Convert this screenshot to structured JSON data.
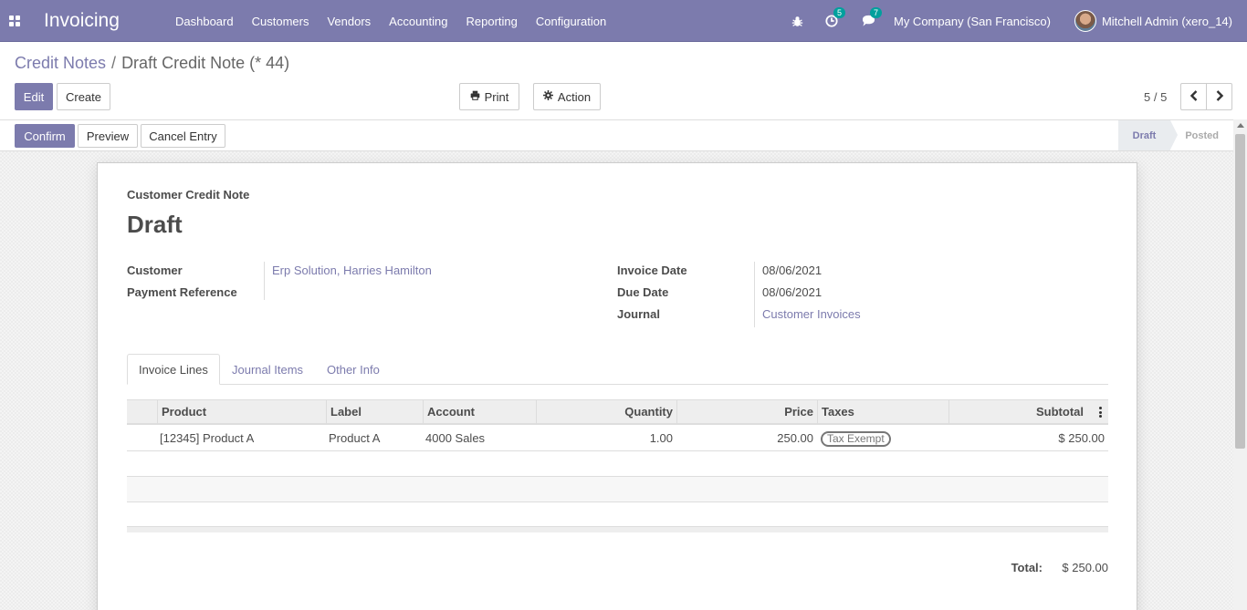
{
  "navbar": {
    "app_name": "Invoicing",
    "menu": [
      "Dashboard",
      "Customers",
      "Vendors",
      "Accounting",
      "Reporting",
      "Configuration"
    ],
    "activity_count": "5",
    "messages_count": "7",
    "company": "My Company (San Francisco)",
    "user": "Mitchell Admin (xero_14)"
  },
  "breadcrumb": {
    "parent": "Credit Notes",
    "separator": "/",
    "current": "Draft Credit Note (* 44)"
  },
  "buttons": {
    "edit": "Edit",
    "create": "Create",
    "print": "Print",
    "action": "Action",
    "confirm": "Confirm",
    "preview": "Preview",
    "cancel_entry": "Cancel Entry"
  },
  "pager": {
    "value": "5 / 5"
  },
  "status": {
    "stages": [
      "Draft",
      "Posted"
    ],
    "active": "Draft"
  },
  "form": {
    "doc_type": "Customer Credit Note",
    "title": "Draft",
    "customer_label": "Customer",
    "customer_value": "Erp Solution, Harries Hamilton",
    "payment_ref_label": "Payment Reference",
    "payment_ref_value": "",
    "invoice_date_label": "Invoice Date",
    "invoice_date_value": "08/06/2021",
    "due_date_label": "Due Date",
    "due_date_value": "08/06/2021",
    "journal_label": "Journal",
    "journal_value": "Customer Invoices"
  },
  "tabs": [
    "Invoice Lines",
    "Journal Items",
    "Other Info"
  ],
  "table": {
    "columns": [
      "Product",
      "Label",
      "Account",
      "Quantity",
      "Price",
      "Taxes",
      "Subtotal"
    ],
    "rows": [
      {
        "product": "[12345] Product A",
        "label": "Product A",
        "account": "4000 Sales",
        "quantity": "1.00",
        "price": "250.00",
        "taxes": "Tax Exempt",
        "subtotal": "$ 250.00"
      }
    ]
  },
  "totals": {
    "label": "Total:",
    "value": "$ 250.00"
  },
  "colors": {
    "primary": "#7c7bad",
    "badge": "#00a09d"
  }
}
